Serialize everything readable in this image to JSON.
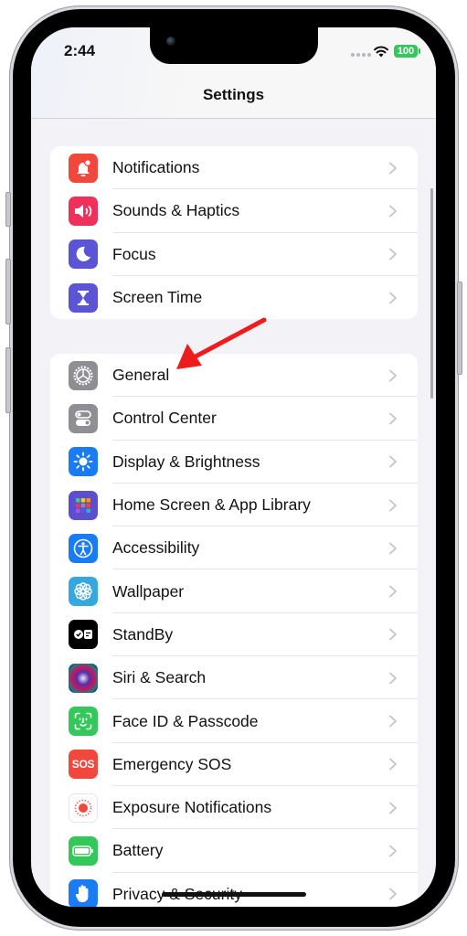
{
  "status_bar": {
    "time": "2:44",
    "battery_level": "100",
    "wifi": "wifi-icon",
    "signal": "signal-dots-icon"
  },
  "header": {
    "title": "Settings"
  },
  "groups": [
    {
      "items": [
        {
          "label": "Notifications",
          "icon": "bell-icon",
          "color": "#f2473c"
        },
        {
          "label": "Sounds & Haptics",
          "icon": "speaker-icon",
          "color": "#f0305a"
        },
        {
          "label": "Focus",
          "icon": "moon-icon",
          "color": "#5b55d6"
        },
        {
          "label": "Screen Time",
          "icon": "hourglass-icon",
          "color": "#5b55d6"
        }
      ]
    },
    {
      "items": [
        {
          "label": "General",
          "icon": "gear-icon",
          "color": "#8e8e93"
        },
        {
          "label": "Control Center",
          "icon": "toggles-icon",
          "color": "#8e8e93"
        },
        {
          "label": "Display & Brightness",
          "icon": "sun-icon",
          "color": "#1a7cf5"
        },
        {
          "label": "Home Screen & App Library",
          "icon": "app-grid-icon",
          "color": "#5b4fd0"
        },
        {
          "label": "Accessibility",
          "icon": "accessibility-icon",
          "color": "#1a7cf5"
        },
        {
          "label": "Wallpaper",
          "icon": "flower-icon",
          "color": "#36a8e0"
        },
        {
          "label": "StandBy",
          "icon": "standby-icon",
          "color": "#000000"
        },
        {
          "label": "Siri & Search",
          "icon": "siri-icon",
          "color": "#1c1c2e"
        },
        {
          "label": "Face ID & Passcode",
          "icon": "face-id-icon",
          "color": "#34c759"
        },
        {
          "label": "Emergency SOS",
          "icon": "sos-icon",
          "color": "#f2473c"
        },
        {
          "label": "Exposure Notifications",
          "icon": "exposure-icon",
          "color": "#ffffff"
        },
        {
          "label": "Battery",
          "icon": "battery-icon",
          "color": "#34c759"
        },
        {
          "label": "Privacy & Security",
          "icon": "hand-icon",
          "color": "#1a7cf5"
        }
      ]
    }
  ],
  "annotation": {
    "type": "red-arrow",
    "points_to": "General",
    "color": "#ee1c1c"
  }
}
